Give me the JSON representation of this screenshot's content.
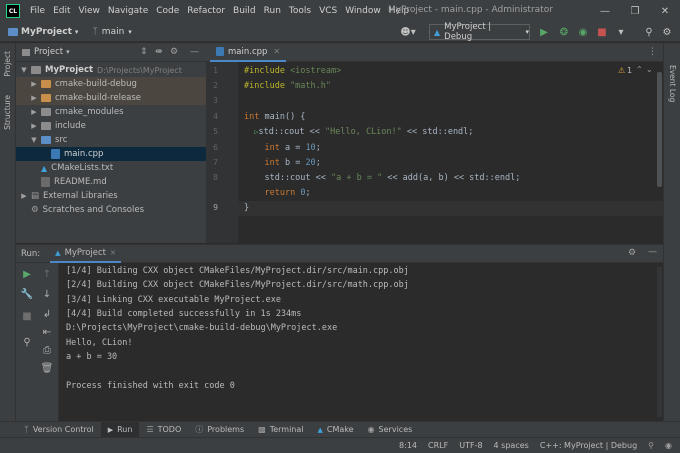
{
  "window": {
    "title": "MyProject - main.cpp - Administrator",
    "menu": [
      "File",
      "Edit",
      "View",
      "Navigate",
      "Code",
      "Refactor",
      "Build",
      "Run",
      "Tools",
      "VCS",
      "Window",
      "Help"
    ],
    "app_logo": "CL"
  },
  "navbar": {
    "project": "MyProject",
    "branch": "main",
    "run_config": "MyProject | Debug"
  },
  "side_tools": {
    "project": "Project",
    "structure": "Structure",
    "right": "Event Log"
  },
  "project_panel": {
    "title": "Project",
    "tree": [
      {
        "label": "MyProject",
        "suffix": "D:\\Projects\\MyProject",
        "level": 0,
        "type": "folder",
        "expanded": true
      },
      {
        "label": "cmake-build-debug",
        "level": 1,
        "type": "folder-orange",
        "expanded": false
      },
      {
        "label": "cmake-build-release",
        "level": 1,
        "type": "folder-orange",
        "expanded": false
      },
      {
        "label": "cmake_modules",
        "level": 1,
        "type": "folder",
        "expanded": false
      },
      {
        "label": "include",
        "level": 1,
        "type": "folder",
        "expanded": false
      },
      {
        "label": "src",
        "level": 1,
        "type": "folder-blue",
        "expanded": true
      },
      {
        "label": "main.cpp",
        "level": 2,
        "type": "cpp-file",
        "selected": true
      },
      {
        "label": "CMakeLists.txt",
        "level": 1,
        "type": "cmake-file"
      },
      {
        "label": "README.md",
        "level": 1,
        "type": "md-file"
      },
      {
        "label": "External Libraries",
        "level": 0,
        "type": "library",
        "expanded": false
      },
      {
        "label": "Scratches and Consoles",
        "level": 0,
        "type": "scratch"
      }
    ]
  },
  "editor": {
    "tab_label": "main.cpp",
    "warning_count": "1",
    "line_numbers": [
      "1",
      "2",
      "3",
      "4",
      "5",
      "6",
      "7",
      "8",
      "9"
    ],
    "current_line": 9
  },
  "run_panel": {
    "label": "Run:",
    "tab": "MyProject",
    "output": [
      "[1/4] Building CXX object CMakeFiles/MyProject.dir/src/main.cpp.obj",
      "[2/4] Building CXX object CMakeFiles/MyProject.dir/src/math.cpp.obj",
      "[3/4] Linking CXX executable MyProject.exe",
      "[4/4] Build completed successfully in 1s 234ms",
      "D:\\Projects\\MyProject\\cmake-build-debug\\MyProject.exe",
      "Hello, CLion!",
      "a + b = 30",
      "",
      "Process finished with exit code 0"
    ]
  },
  "bottom_tabs": [
    "Version Control",
    "Run",
    "TODO",
    "Problems",
    "Terminal",
    "CMake",
    "Services"
  ],
  "status_bar": {
    "position": "8:14",
    "line_ending": "CRLF",
    "encoding": "UTF-8",
    "indent": "4 spaces",
    "context": "C++: MyProject | Debug"
  }
}
